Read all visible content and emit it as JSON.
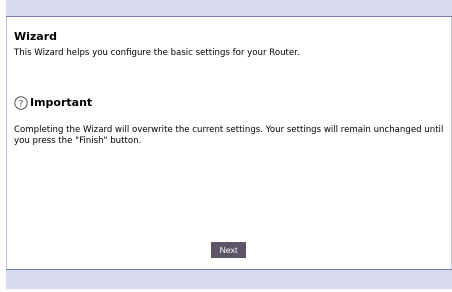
{
  "wizard": {
    "title": "Wizard",
    "intro": "This Wizard helps you configure the basic settings for your Router."
  },
  "important": {
    "icon": "question-circle-icon",
    "title": "Important",
    "text": "Completing the Wizard will overwrite the current settings. Your settings will remain unchanged until you press the \"Finish\" button."
  },
  "actions": {
    "next_label": "Next"
  },
  "colors": {
    "bar_background": "#d8d9f0",
    "button_background": "#5d5466"
  }
}
